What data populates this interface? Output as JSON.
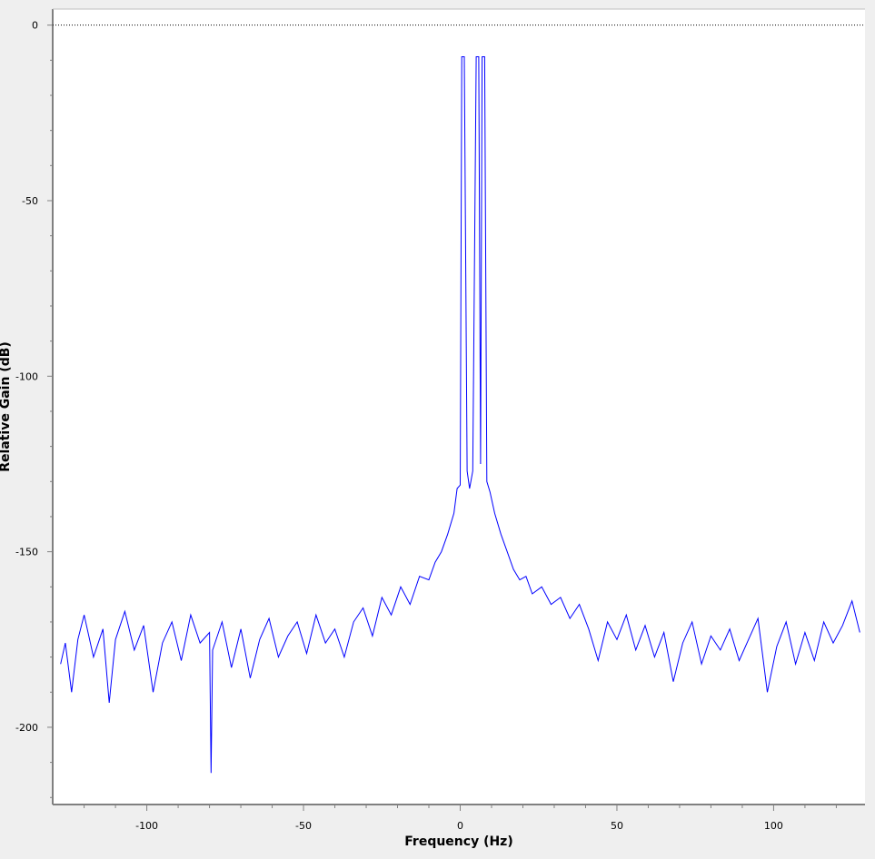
{
  "chart_data": {
    "type": "line",
    "title": "",
    "xlabel": "Frequency (Hz)",
    "ylabel": "Relative Gain (dB)",
    "xlim": [
      -128,
      128
    ],
    "ylim": [
      -222,
      2.5
    ],
    "x_ticks": [
      -100,
      -50,
      0,
      50,
      100
    ],
    "y_ticks": [
      0,
      -50,
      -100,
      -150,
      -200
    ],
    "x_tick_labels": [
      "-100",
      "-50",
      "0",
      "50",
      "100"
    ],
    "y_tick_labels": [
      "0",
      "-50",
      "-100",
      "-150",
      "-200"
    ],
    "grid": false,
    "legend": "none",
    "reference_line": {
      "y": 0,
      "style": "dotted",
      "color": "#000000"
    },
    "series": [
      {
        "color": "#0000ff",
        "peaks": [
          {
            "x": 1,
            "y": -9
          },
          {
            "x": 5.5,
            "y": -9
          },
          {
            "x": 7.5,
            "y": -9
          }
        ],
        "peak_valleys": [
          {
            "x": 3.2,
            "y": -132
          },
          {
            "x": 6.5,
            "y": -127
          }
        ],
        "noise_floor_level_edges": -172,
        "near_peak_floor": -130,
        "points": [
          [
            -127.5,
            -182
          ],
          [
            -126,
            -176
          ],
          [
            -124,
            -190
          ],
          [
            -122,
            -175
          ],
          [
            -120,
            -168
          ],
          [
            -117,
            -180
          ],
          [
            -114,
            -172
          ],
          [
            -112,
            -193
          ],
          [
            -110,
            -175
          ],
          [
            -107,
            -167
          ],
          [
            -104,
            -178
          ],
          [
            -101,
            -171
          ],
          [
            -98,
            -190
          ],
          [
            -95,
            -176
          ],
          [
            -92,
            -170
          ],
          [
            -89,
            -181
          ],
          [
            -86,
            -168
          ],
          [
            -83,
            -176
          ],
          [
            -80,
            -173
          ],
          [
            -79.5,
            -213
          ],
          [
            -79,
            -178
          ],
          [
            -76,
            -170
          ],
          [
            -73,
            -183
          ],
          [
            -70,
            -172
          ],
          [
            -67,
            -186
          ],
          [
            -64,
            -175
          ],
          [
            -61,
            -169
          ],
          [
            -58,
            -180
          ],
          [
            -55,
            -174
          ],
          [
            -52,
            -170
          ],
          [
            -49,
            -179
          ],
          [
            -46,
            -168
          ],
          [
            -43,
            -176
          ],
          [
            -40,
            -172
          ],
          [
            -37,
            -180
          ],
          [
            -34,
            -170
          ],
          [
            -31,
            -166
          ],
          [
            -28,
            -174
          ],
          [
            -25,
            -163
          ],
          [
            -22,
            -168
          ],
          [
            -19,
            -160
          ],
          [
            -16,
            -165
          ],
          [
            -13,
            -157
          ],
          [
            -10,
            -158
          ],
          [
            -8,
            -153
          ],
          [
            -6,
            -150
          ],
          [
            -4,
            -145
          ],
          [
            -2,
            -139
          ],
          [
            -1,
            -132
          ],
          [
            0,
            -131
          ],
          [
            0.5,
            -9
          ],
          [
            1.3,
            -9
          ],
          [
            2.2,
            -127
          ],
          [
            3,
            -132
          ],
          [
            4,
            -127
          ],
          [
            5.1,
            -9
          ],
          [
            5.9,
            -9
          ],
          [
            6.5,
            -125
          ],
          [
            7,
            -9
          ],
          [
            7.8,
            -9
          ],
          [
            8.5,
            -130
          ],
          [
            9.5,
            -133
          ],
          [
            11,
            -139
          ],
          [
            13,
            -145
          ],
          [
            15,
            -150
          ],
          [
            17,
            -155
          ],
          [
            19,
            -158
          ],
          [
            21,
            -157
          ],
          [
            23,
            -162
          ],
          [
            26,
            -160
          ],
          [
            29,
            -165
          ],
          [
            32,
            -163
          ],
          [
            35,
            -169
          ],
          [
            38,
            -165
          ],
          [
            41,
            -172
          ],
          [
            44,
            -181
          ],
          [
            47,
            -170
          ],
          [
            50,
            -175
          ],
          [
            53,
            -168
          ],
          [
            56,
            -178
          ],
          [
            59,
            -171
          ],
          [
            62,
            -180
          ],
          [
            65,
            -173
          ],
          [
            68,
            -187
          ],
          [
            71,
            -176
          ],
          [
            74,
            -170
          ],
          [
            77,
            -182
          ],
          [
            80,
            -174
          ],
          [
            83,
            -178
          ],
          [
            86,
            -172
          ],
          [
            89,
            -181
          ],
          [
            92,
            -175
          ],
          [
            95,
            -169
          ],
          [
            98,
            -190
          ],
          [
            101,
            -177
          ],
          [
            104,
            -170
          ],
          [
            107,
            -182
          ],
          [
            110,
            -173
          ],
          [
            113,
            -181
          ],
          [
            116,
            -170
          ],
          [
            119,
            -176
          ],
          [
            122,
            -171
          ],
          [
            125,
            -164
          ],
          [
            127.5,
            -173
          ]
        ]
      }
    ]
  }
}
